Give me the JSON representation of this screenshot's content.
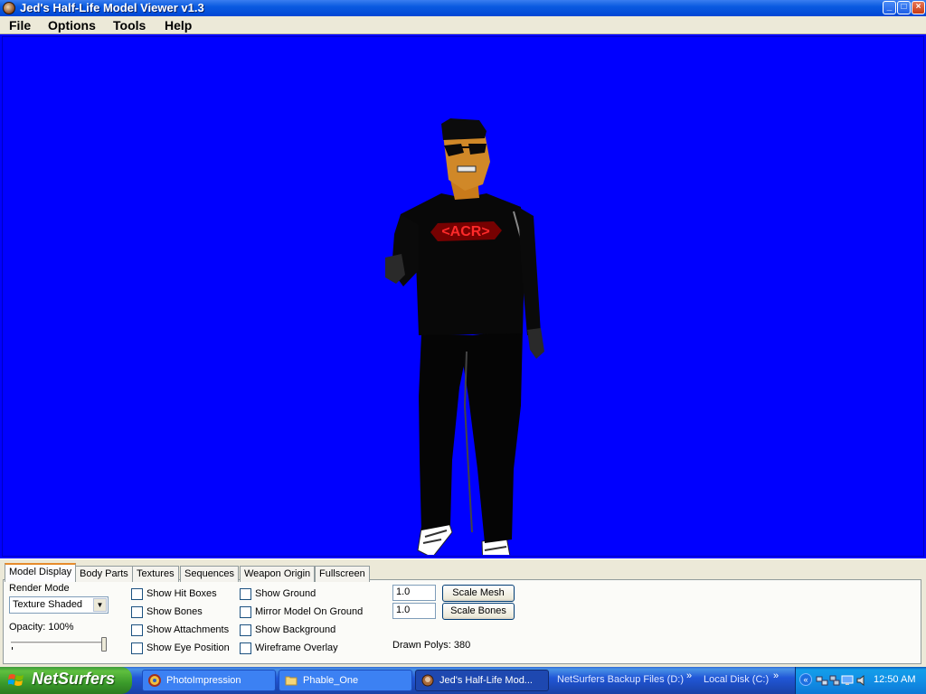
{
  "window": {
    "title": "Jed's Half-Life Model Viewer v1.3",
    "buttons": {
      "minimize": "_",
      "maximize": "□",
      "close": "×"
    }
  },
  "menu": {
    "items": [
      {
        "label": "File"
      },
      {
        "label": "Options"
      },
      {
        "label": "Tools"
      },
      {
        "label": "Help"
      }
    ]
  },
  "viewport": {
    "background_color": "#0000ff",
    "model_logo_text": "<ACR>"
  },
  "tabs": [
    {
      "label": "Model Display",
      "active": true
    },
    {
      "label": "Body Parts"
    },
    {
      "label": "Textures"
    },
    {
      "label": "Sequences"
    },
    {
      "label": "Weapon Origin"
    },
    {
      "label": "Fullscreen"
    }
  ],
  "model_display": {
    "render_mode_label": "Render Mode",
    "render_mode_value": "Texture Shaded",
    "opacity_label": "Opacity: 100%",
    "opacity_value": 100,
    "checkboxes_col1": [
      {
        "label": "Show Hit Boxes",
        "checked": false
      },
      {
        "label": "Show Bones",
        "checked": false
      },
      {
        "label": "Show Attachments",
        "checked": false
      },
      {
        "label": "Show Eye Position",
        "checked": false
      }
    ],
    "checkboxes_col2": [
      {
        "label": "Show Ground",
        "checked": false
      },
      {
        "label": "Mirror Model On Ground",
        "checked": false
      },
      {
        "label": "Show Background",
        "checked": false
      },
      {
        "label": "Wireframe Overlay",
        "checked": false
      }
    ],
    "scale_mesh_value": "1.0",
    "scale_mesh_button": "Scale Mesh",
    "scale_bones_value": "1.0",
    "scale_bones_button": "Scale Bones",
    "drawn_polys": "Drawn Polys: 380"
  },
  "taskbar": {
    "start_label": "NetSurfers",
    "tasks": [
      {
        "label": "PhotoImpression",
        "icon": "photoimpression-icon",
        "active": false
      },
      {
        "label": "Phable_One",
        "icon": "folder-icon",
        "active": false
      },
      {
        "label": "Jed's Half-Life Mod...",
        "icon": "app-icon",
        "active": true
      }
    ],
    "quick_links": [
      {
        "label": "NetSurfers Backup Files (D:)"
      },
      {
        "label": "Local Disk (C:)"
      }
    ],
    "chevron": "»",
    "tray_chevron": "«",
    "clock": "12:50 AM"
  }
}
